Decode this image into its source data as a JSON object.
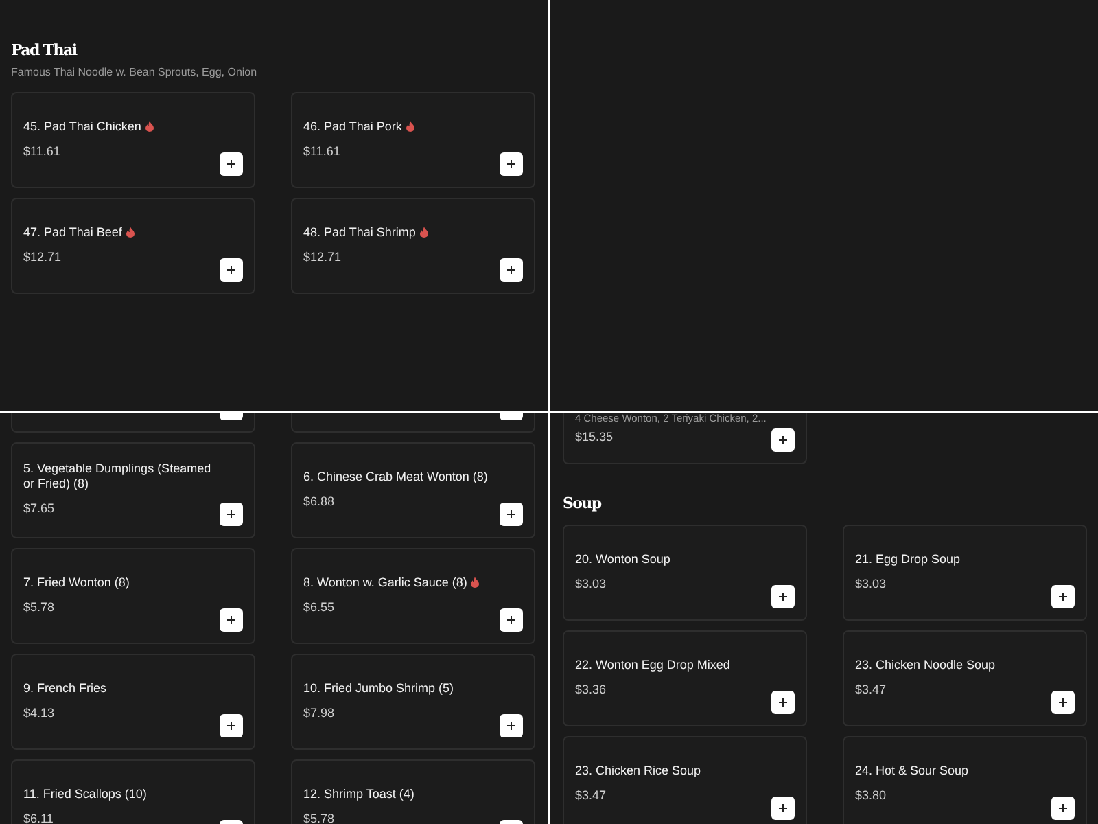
{
  "panels": [
    {
      "kind": "menu",
      "sections": [
        {
          "kind": "heading",
          "title": "Pad Thai",
          "subtitle": "Famous Thai Noodle w. Bean Sprouts, Egg, Onion"
        },
        {
          "kind": "grid",
          "items": [
            {
              "kind": "dish",
              "name": "45. Pad Thai Chicken",
              "price": "$11.61",
              "spicy": true
            },
            {
              "kind": "dish",
              "name": "46. Pad Thai Pork",
              "price": "$11.61",
              "spicy": true
            },
            {
              "kind": "dish",
              "name": "47. Pad Thai Beef",
              "price": "$12.71",
              "spicy": true
            },
            {
              "kind": "dish",
              "name": "48. Pad Thai Shrimp",
              "price": "$12.71",
              "spicy": true
            }
          ]
        }
      ]
    },
    {
      "kind": "empty"
    },
    {
      "kind": "menu",
      "sections": [
        {
          "kind": "grid",
          "items": [
            {
              "kind": "cut"
            },
            {
              "kind": "cut"
            },
            {
              "kind": "dish",
              "name": "5. Vegetable Dumplings (Steamed or Fried) (8)",
              "price": "$7.65",
              "spicy": false
            },
            {
              "kind": "dish",
              "name": "6. Chinese Crab Meat Wonton (8)",
              "price": "$6.88",
              "spicy": false
            },
            {
              "kind": "dish",
              "name": "7. Fried Wonton (8)",
              "price": "$5.78",
              "spicy": false
            },
            {
              "kind": "dish",
              "name": "8. Wonton w. Garlic Sauce (8)",
              "price": "$6.55",
              "spicy": true
            },
            {
              "kind": "dish",
              "name": "9. French Fries",
              "price": "$4.13",
              "spicy": false
            },
            {
              "kind": "dish",
              "name": "10. Fried Jumbo Shrimp (5)",
              "price": "$7.98",
              "spicy": false
            },
            {
              "kind": "dish",
              "name": "11. Fried Scallops (10)",
              "price": "$6.11",
              "spicy": false
            },
            {
              "kind": "dish",
              "name": "12. Shrimp Toast (4)",
              "price": "$5.78",
              "spicy": false
            }
          ]
        }
      ]
    },
    {
      "kind": "menu",
      "sections": [
        {
          "kind": "grid",
          "items": [
            {
              "kind": "partial",
              "description": "4 Cheese Wonton, 2 Teriyaki Chicken, 2...",
              "price": "$15.35"
            }
          ]
        },
        {
          "kind": "heading",
          "title": "Soup"
        },
        {
          "kind": "grid",
          "items": [
            {
              "kind": "dish",
              "name": "20. Wonton Soup",
              "price": "$3.03",
              "spicy": false
            },
            {
              "kind": "dish",
              "name": "21. Egg Drop Soup",
              "price": "$3.03",
              "spicy": false
            },
            {
              "kind": "dish",
              "name": "22. Wonton Egg Drop Mixed",
              "price": "$3.36",
              "spicy": false
            },
            {
              "kind": "dish",
              "name": "23. Chicken Noodle Soup",
              "price": "$3.47",
              "spicy": false
            },
            {
              "kind": "dish",
              "name": "23. Chicken Rice Soup",
              "price": "$3.47",
              "spicy": false
            },
            {
              "kind": "dish",
              "name": "24. Hot & Sour Soup",
              "price": "$3.80",
              "spicy": false
            }
          ]
        }
      ]
    }
  ]
}
